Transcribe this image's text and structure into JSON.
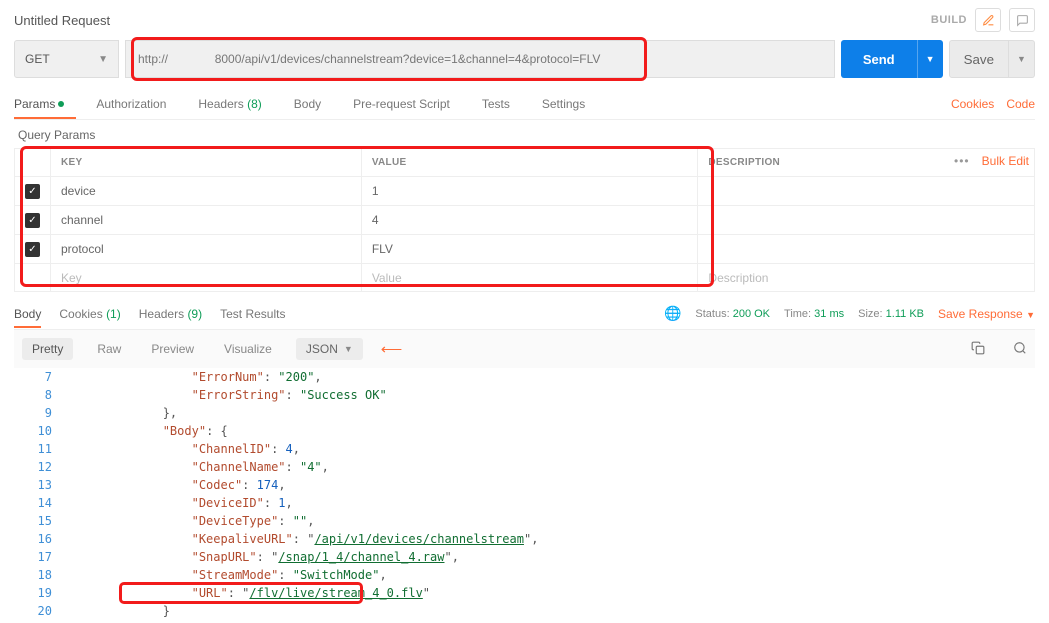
{
  "title": "Untitled Request",
  "build_label": "BUILD",
  "request": {
    "method": "GET",
    "url": "http://              8000/api/v1/devices/channelstream?device=1&channel=4&protocol=FLV",
    "send": "Send",
    "save": "Save"
  },
  "req_tabs": {
    "params": "Params",
    "authorization": "Authorization",
    "headers": "Headers",
    "headers_count": "(8)",
    "body": "Body",
    "prereq": "Pre-request Script",
    "tests": "Tests",
    "settings": "Settings",
    "cookies": "Cookies",
    "code": "Code"
  },
  "qp": {
    "title": "Query Params",
    "cols": {
      "key": "KEY",
      "value": "VALUE",
      "desc": "DESCRIPTION"
    },
    "rows": [
      {
        "checked": true,
        "key": "device",
        "value": "1"
      },
      {
        "checked": true,
        "key": "channel",
        "value": "4"
      },
      {
        "checked": true,
        "key": "protocol",
        "value": "FLV"
      }
    ],
    "placeholder": {
      "key": "Key",
      "value": "Value",
      "desc": "Description"
    },
    "bulk_edit": "Bulk Edit"
  },
  "resp_tabs": {
    "body": "Body",
    "cookies": "Cookies",
    "cookies_count": "(1)",
    "headers": "Headers",
    "headers_count": "(9)",
    "test_results": "Test Results",
    "status_lbl": "Status:",
    "status_val": "200 OK",
    "time_lbl": "Time:",
    "time_val": "31 ms",
    "size_lbl": "Size:",
    "size_val": "1.11 KB",
    "save_resp": "Save Response"
  },
  "resp_toolbar": {
    "pretty": "Pretty",
    "raw": "Raw",
    "preview": "Preview",
    "visualize": "Visualize",
    "fmt": "JSON"
  },
  "code": {
    "lines": [
      {
        "n": 7,
        "indent": 16,
        "type": "kv",
        "key": "ErrorNum",
        "vtype": "str",
        "val": "200",
        "comma": true
      },
      {
        "n": 8,
        "indent": 16,
        "type": "kv",
        "key": "ErrorString",
        "vtype": "str",
        "val": "Success OK",
        "comma": false
      },
      {
        "n": 9,
        "indent": 12,
        "type": "close",
        "txt": "},"
      },
      {
        "n": 10,
        "indent": 12,
        "type": "kv",
        "key": "Body",
        "vtype": "open",
        "val": "{",
        "comma": false
      },
      {
        "n": 11,
        "indent": 16,
        "type": "kv",
        "key": "ChannelID",
        "vtype": "num",
        "val": "4",
        "comma": true
      },
      {
        "n": 12,
        "indent": 16,
        "type": "kv",
        "key": "ChannelName",
        "vtype": "str",
        "val": "4",
        "comma": true
      },
      {
        "n": 13,
        "indent": 16,
        "type": "kv",
        "key": "Codec",
        "vtype": "num",
        "val": "174",
        "comma": true
      },
      {
        "n": 14,
        "indent": 16,
        "type": "kv",
        "key": "DeviceID",
        "vtype": "num",
        "val": "1",
        "comma": true
      },
      {
        "n": 15,
        "indent": 16,
        "type": "kv",
        "key": "DeviceType",
        "vtype": "str",
        "val": "",
        "comma": true
      },
      {
        "n": 16,
        "indent": 16,
        "type": "kv",
        "key": "KeepaliveURL",
        "vtype": "url",
        "val": "/api/v1/devices/channelstream",
        "comma": true
      },
      {
        "n": 17,
        "indent": 16,
        "type": "kv",
        "key": "SnapURL",
        "vtype": "url",
        "val": "/snap/1_4/channel_4.raw",
        "comma": true
      },
      {
        "n": 18,
        "indent": 16,
        "type": "kv",
        "key": "StreamMode",
        "vtype": "str",
        "val": "SwitchMode",
        "comma": true
      },
      {
        "n": 19,
        "indent": 16,
        "type": "kv",
        "key": "URL",
        "vtype": "url",
        "val": "/flv/live/stream_4_0.flv",
        "comma": false
      },
      {
        "n": 20,
        "indent": 12,
        "type": "close",
        "txt": "}"
      }
    ]
  }
}
